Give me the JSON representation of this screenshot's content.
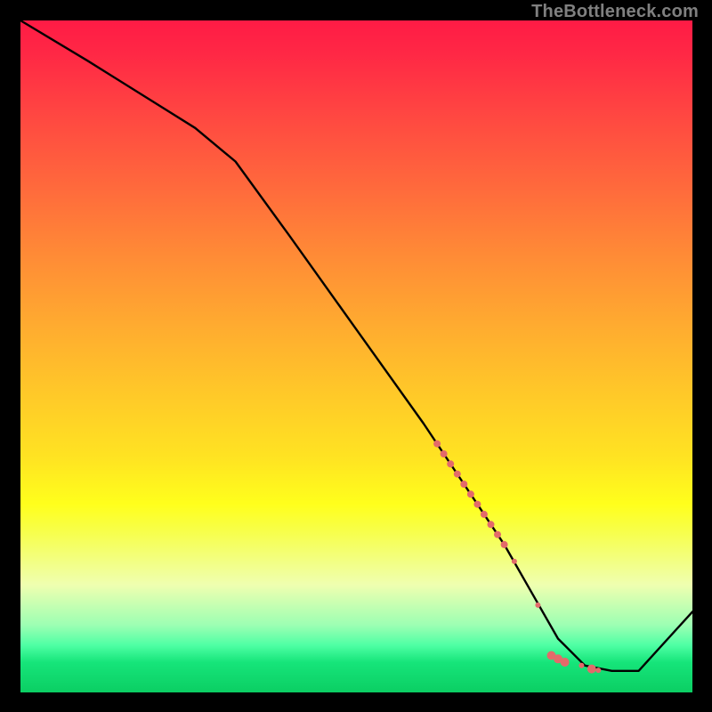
{
  "watermark": "TheBottleneck.com",
  "chart_data": {
    "type": "line",
    "title": "",
    "xlabel": "",
    "ylabel": "",
    "xlim": [
      0,
      100
    ],
    "ylim": [
      0,
      100
    ],
    "series": [
      {
        "name": "curve",
        "x": [
          0,
          10,
          26,
          32,
          40,
          50,
          60,
          68,
          72,
          76,
          80,
          84,
          88,
          92,
          100
        ],
        "y": [
          100,
          94,
          84,
          79,
          68,
          54,
          40,
          28,
          22,
          15,
          8,
          4,
          3.2,
          3.2,
          12
        ]
      }
    ],
    "markers": {
      "name": "highlight-cluster",
      "color": "#e36a6a",
      "points": [
        {
          "x": 62,
          "y": 37,
          "r": 4
        },
        {
          "x": 63,
          "y": 35.5,
          "r": 4
        },
        {
          "x": 64,
          "y": 34,
          "r": 4
        },
        {
          "x": 65,
          "y": 32.5,
          "r": 4
        },
        {
          "x": 66,
          "y": 31,
          "r": 4
        },
        {
          "x": 67,
          "y": 29.5,
          "r": 4
        },
        {
          "x": 68,
          "y": 28,
          "r": 4
        },
        {
          "x": 69,
          "y": 26.5,
          "r": 4
        },
        {
          "x": 70,
          "y": 25,
          "r": 4
        },
        {
          "x": 71,
          "y": 23.5,
          "r": 4
        },
        {
          "x": 72,
          "y": 22,
          "r": 4
        },
        {
          "x": 73.5,
          "y": 19.5,
          "r": 3
        },
        {
          "x": 77,
          "y": 13,
          "r": 3
        },
        {
          "x": 79,
          "y": 5.5,
          "r": 5
        },
        {
          "x": 80,
          "y": 5,
          "r": 5
        },
        {
          "x": 81,
          "y": 4.5,
          "r": 5
        },
        {
          "x": 83.5,
          "y": 4,
          "r": 3
        },
        {
          "x": 85,
          "y": 3.5,
          "r": 5
        },
        {
          "x": 86,
          "y": 3.3,
          "r": 3
        }
      ]
    }
  }
}
